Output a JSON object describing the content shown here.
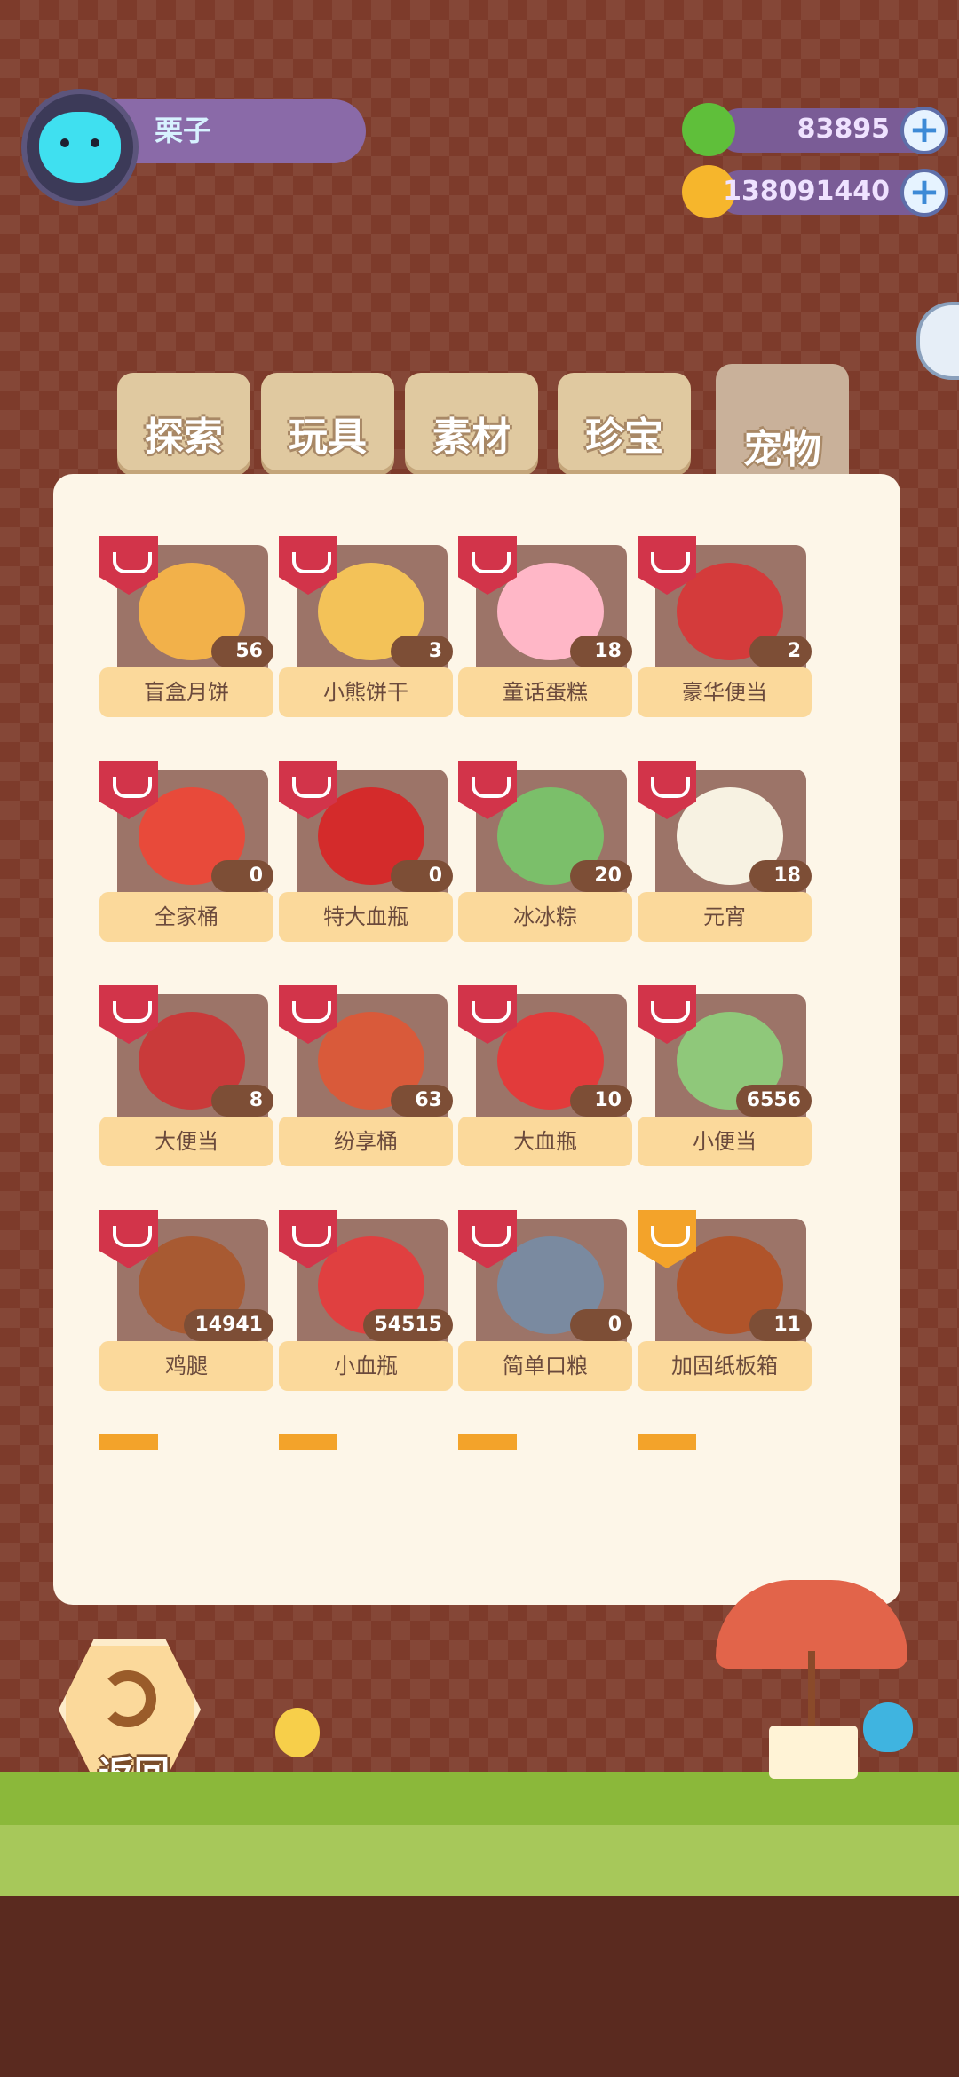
{
  "player": {
    "name": "栗子"
  },
  "currencies": [
    {
      "name": "green-gem",
      "value": "83895",
      "color": "#5fbf3a"
    },
    {
      "name": "gold-planet",
      "value": "138091440",
      "color": "#f6b62c"
    }
  ],
  "tabs": [
    "探索",
    "玩具",
    "素材",
    "珍宝",
    "宠物"
  ],
  "active_tab": "宠物",
  "items": [
    {
      "label": "盲盒月饼",
      "count": "56",
      "tag": "food",
      "color": "#f2b14a"
    },
    {
      "label": "小熊饼干",
      "count": "3",
      "tag": "food",
      "color": "#f3c258"
    },
    {
      "label": "童话蛋糕",
      "count": "18",
      "tag": "food",
      "color": "#ffb7c7"
    },
    {
      "label": "豪华便当",
      "count": "2",
      "tag": "food",
      "color": "#d43b3b"
    },
    {
      "label": "全家桶",
      "count": "0",
      "tag": "food",
      "color": "#e84a3a"
    },
    {
      "label": "特大血瓶",
      "count": "0",
      "tag": "food",
      "color": "#d42b2b"
    },
    {
      "label": "冰冰粽",
      "count": "20",
      "tag": "food",
      "color": "#7bbf6a"
    },
    {
      "label": "元宵",
      "count": "18",
      "tag": "food",
      "color": "#f7f2e2"
    },
    {
      "label": "大便当",
      "count": "8",
      "tag": "food",
      "color": "#c93a3a"
    },
    {
      "label": "纷享桶",
      "count": "63",
      "tag": "food",
      "color": "#d95a3a"
    },
    {
      "label": "大血瓶",
      "count": "10",
      "tag": "food",
      "color": "#e23b3b"
    },
    {
      "label": "小便当",
      "count": "6556",
      "tag": "food",
      "color": "#8fc87a"
    },
    {
      "label": "鸡腿",
      "count": "14941",
      "tag": "food",
      "color": "#a85a32"
    },
    {
      "label": "小血瓶",
      "count": "54515",
      "tag": "food",
      "color": "#e04040"
    },
    {
      "label": "简单口粮",
      "count": "0",
      "tag": "food",
      "color": "#7a8aa0"
    },
    {
      "label": "加固纸板箱",
      "count": "11",
      "tag": "tool",
      "color": "#b0542a"
    }
  ],
  "back_label": "返回"
}
